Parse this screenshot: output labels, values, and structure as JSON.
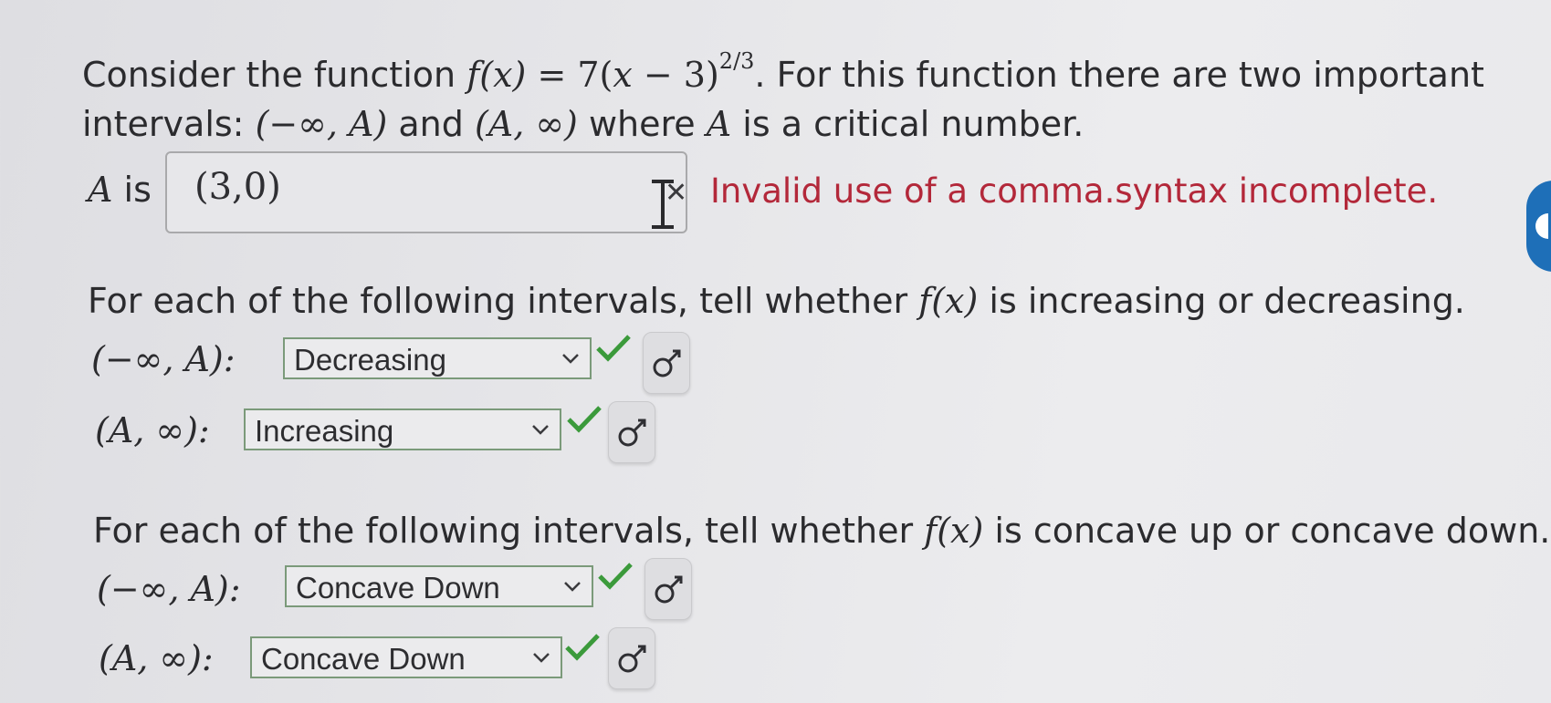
{
  "intro": {
    "line1_pre": "Consider the function ",
    "f_name": "f",
    "x_var": "(x)",
    "equals": " = 7(",
    "x2": "x",
    "minus3": " − 3)",
    "exponent": "2/3",
    "line1_post": ". For this function there are two important",
    "line2_pre": "intervals: ",
    "int1": "(−∞, A)",
    "and": " and ",
    "int2": "(A, ∞)",
    "line2_post_pre": " where ",
    "A": "A",
    "line2_post": " is a critical number."
  },
  "critical": {
    "label_var": "A",
    "label_is": " is",
    "value": "(3,0)",
    "error": "Invalid use of a comma.syntax incomplete."
  },
  "increasing_section": {
    "prompt_pre": "For each of the following intervals, tell whether ",
    "fx": "f(x)",
    "prompt_post": " is increasing or decreasing.",
    "rows": [
      {
        "interval": "(−∞, A):",
        "selected": "Decreasing"
      },
      {
        "interval": "(A, ∞):",
        "selected": "Increasing"
      }
    ]
  },
  "concavity_section": {
    "prompt_pre": "For each of the following intervals, tell whether ",
    "fx": "f(x)",
    "prompt_post": " is concave up or concave down.",
    "rows": [
      {
        "interval": "(−∞, A):",
        "selected": "Concave Down"
      },
      {
        "interval": "(A, ∞):",
        "selected": "Concave Down"
      }
    ]
  },
  "colors": {
    "error": "#b3283a",
    "check": "#3b9a3b",
    "select_border": "#7b9a7a",
    "side_tab": "#1e6fb8"
  },
  "icons": {
    "check": "check-icon",
    "gear": "gear-icon",
    "chevron": "chevron-down-icon",
    "cursor": "text-cursor-icon"
  }
}
